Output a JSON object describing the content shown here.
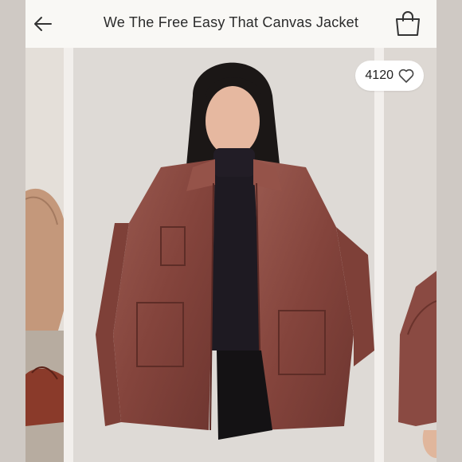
{
  "header": {
    "title": "We The Free Easy That Canvas Jacket",
    "back_icon": "arrow-left-icon",
    "bag_icon": "shopping-bag-icon"
  },
  "likes": {
    "count": "4120",
    "icon": "heart-outline-icon"
  },
  "colors": {
    "jacket": "#8a4a42",
    "background": "#f7f5f2"
  }
}
